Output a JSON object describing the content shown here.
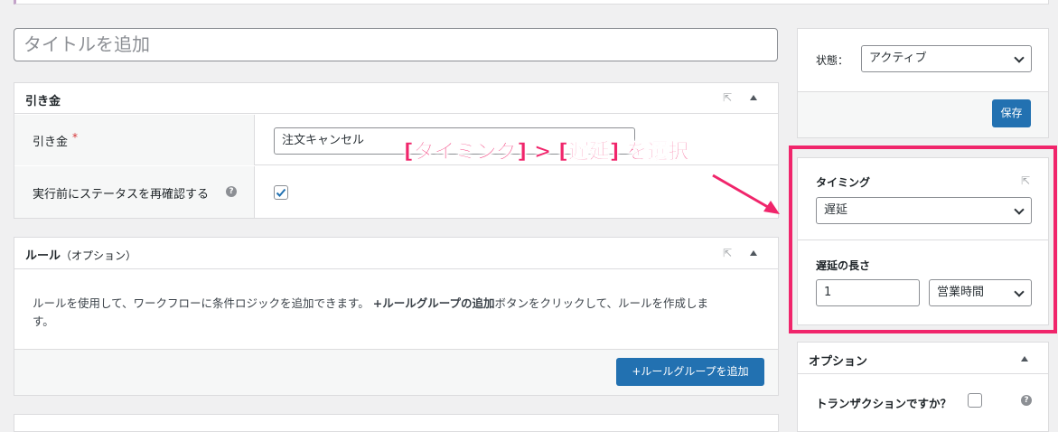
{
  "title_placeholder": "タイトルを追加",
  "hikikin_box": {
    "title": "引き金",
    "trigger_label": "引き金",
    "required_mark": "*",
    "trigger_value": "注文キャンセル",
    "recheck_label": "実行前にステータスを再確認する",
    "recheck_checked": true
  },
  "rules_box": {
    "title": "ルール",
    "subtitle": "（オプション）",
    "description_part1": "ルールを使用して、ワークフローに条件ロジックを追加できます。 ",
    "description_bold": "+ルールグループの追加",
    "description_part2": "ボタンをクリックして、ルールを作成しま",
    "description_part3": "す。",
    "add_button": "+ルールグループを追加"
  },
  "sidebar": {
    "status_label": "状態：",
    "status_value": "アクティブ",
    "save_button": "保存",
    "timing_label": "タイミング",
    "timing_value": "遅延",
    "delay_length_label": "遅延の長さ",
    "delay_length_value": "1",
    "delay_unit_value": "営業時間",
    "options_title": "オプション",
    "transaction_label": "トランザクションですか？"
  },
  "annotation": {
    "text": "[タイミング] > [遅延] を選択",
    "color": "#f0256b"
  },
  "colors": {
    "primary_button": "#2271b1",
    "highlight": "#f0256b"
  }
}
